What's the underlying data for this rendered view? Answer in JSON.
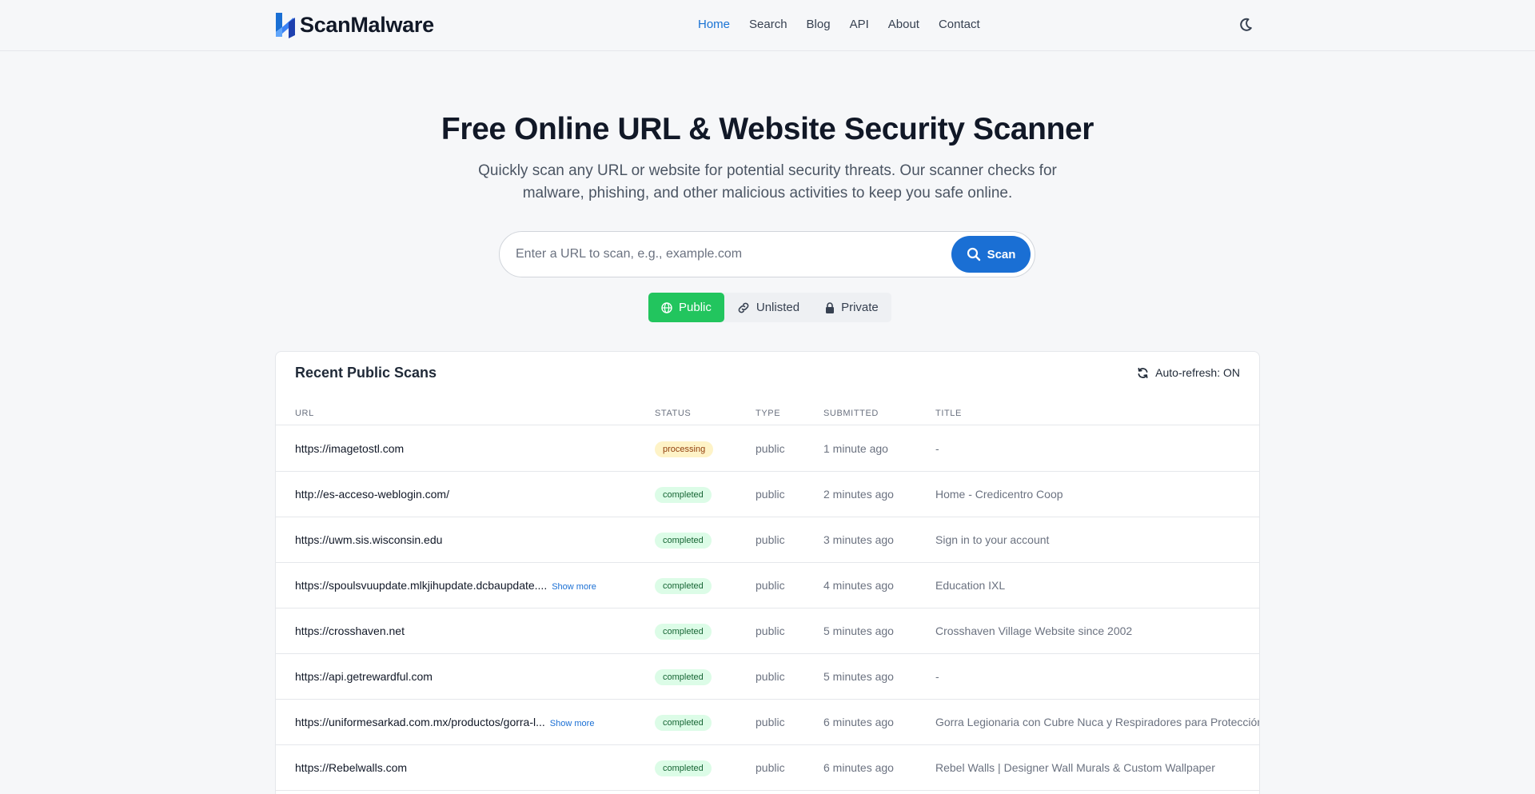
{
  "brand": {
    "name": "ScanMalware"
  },
  "nav": [
    {
      "label": "Home",
      "active": true
    },
    {
      "label": "Search"
    },
    {
      "label": "Blog"
    },
    {
      "label": "API"
    },
    {
      "label": "About"
    },
    {
      "label": "Contact"
    }
  ],
  "hero": {
    "title": "Free Online URL & Website Security Scanner",
    "subtitle": "Quickly scan any URL or website for potential security threats. Our scanner checks for malware, phishing, and other malicious activities to keep you safe online."
  },
  "search": {
    "placeholder": "Enter a URL to scan, e.g., example.com",
    "value": "",
    "button_label": "Scan"
  },
  "visibility": {
    "options": [
      {
        "label": "Public",
        "icon": "globe-icon",
        "active": true
      },
      {
        "label": "Unlisted",
        "icon": "link-icon"
      },
      {
        "label": "Private",
        "icon": "lock-icon"
      }
    ]
  },
  "recent": {
    "title": "Recent Public Scans",
    "auto_refresh": "Auto-refresh: ON",
    "columns": [
      "URL",
      "Status",
      "Type",
      "Submitted",
      "Title"
    ],
    "show_more_label": "Show more",
    "rows": [
      {
        "url": "https://imagetostl.com",
        "show_more": false,
        "status": "processing",
        "type": "public",
        "submitted": "1 minute ago",
        "title": "-"
      },
      {
        "url": "http://es-acceso-weblogin.com/",
        "show_more": false,
        "status": "completed",
        "type": "public",
        "submitted": "2 minutes ago",
        "title": "Home - Credicentro Coop"
      },
      {
        "url": "https://uwm.sis.wisconsin.edu",
        "show_more": false,
        "status": "completed",
        "type": "public",
        "submitted": "3 minutes ago",
        "title": "Sign in to your account"
      },
      {
        "url": "https://spoulsvuupdate.mlkjihupdate.dcbaupdate....",
        "show_more": true,
        "status": "completed",
        "type": "public",
        "submitted": "4 minutes ago",
        "title": "Education IXL"
      },
      {
        "url": "https://crosshaven.net",
        "show_more": false,
        "status": "completed",
        "type": "public",
        "submitted": "5 minutes ago",
        "title": "Crosshaven Village Website since 2002"
      },
      {
        "url": "https://api.getrewardful.com",
        "show_more": false,
        "status": "completed",
        "type": "public",
        "submitted": "5 minutes ago",
        "title": "-"
      },
      {
        "url": "https://uniformesarkad.com.mx/productos/gorra-l...",
        "show_more": true,
        "status": "completed",
        "type": "public",
        "submitted": "6 minutes ago",
        "title": "Gorra Legionaria con Cubre Nuca y Respiradores para Protección Solar"
      },
      {
        "url": "https://Rebelwalls.com",
        "show_more": false,
        "status": "completed",
        "type": "public",
        "submitted": "6 minutes ago",
        "title": "Rebel Walls | Designer Wall Murals & Custom Wallpaper"
      }
    ]
  },
  "colors": {
    "accent": "#1a6fd4",
    "public_active": "#22c55e",
    "processing_badge": "#fef3c7",
    "completed_badge": "#dcfce7"
  }
}
